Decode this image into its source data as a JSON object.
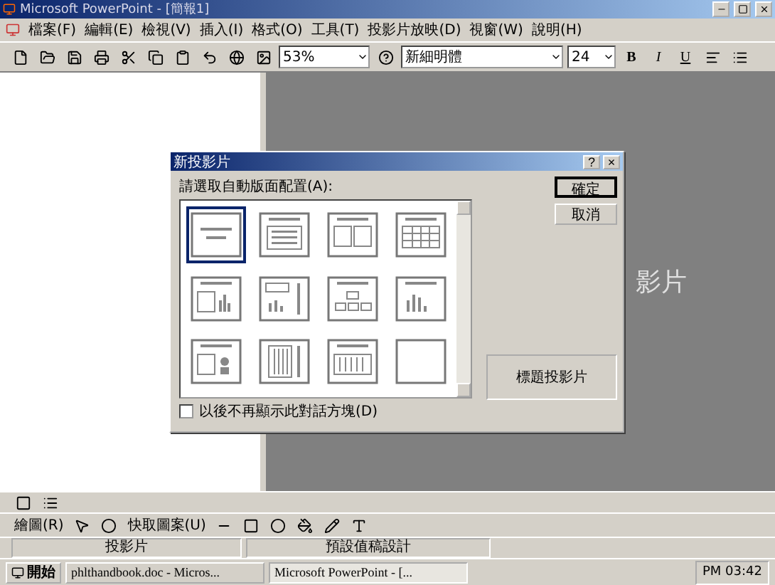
{
  "window": {
    "title": "Microsoft PowerPoint - [簡報1]"
  },
  "menu": [
    "檔案(F)",
    "編輯(E)",
    "檢視(V)",
    "插入(I)",
    "格式(O)",
    "工具(T)",
    "投影片放映(D)",
    "視窗(W)",
    "說明(H)"
  ],
  "toolbar": {
    "zoom": "53%",
    "font": "新細明體",
    "size": "24",
    "bold": "B",
    "italic": "I",
    "underline": "U"
  },
  "slide": {
    "text": "影片"
  },
  "dialog": {
    "title": "新投影片",
    "help": "?",
    "close": "×",
    "prompt": "請選取自動版面配置(A):",
    "layouts": [
      {
        "kind": "title",
        "selected": true
      },
      {
        "kind": "bullets",
        "selected": false
      },
      {
        "kind": "twocol",
        "selected": false
      },
      {
        "kind": "table",
        "selected": false
      },
      {
        "kind": "textchart",
        "selected": false
      },
      {
        "kind": "chartside",
        "selected": false
      },
      {
        "kind": "org",
        "selected": false
      },
      {
        "kind": "chart",
        "selected": false
      },
      {
        "kind": "textart",
        "selected": false
      },
      {
        "kind": "vertical",
        "selected": false
      },
      {
        "kind": "vtable",
        "selected": false
      },
      {
        "kind": "blank",
        "selected": false
      }
    ],
    "buttons": [
      "確定",
      "取消"
    ],
    "preview": "標題投影片",
    "checkbox": {
      "label": "以後不再顯示此對話方塊(D)",
      "checked": false
    }
  },
  "drawing_toolbar": {
    "draw": "繪圖(R)",
    "autoshapes": "快取圖案(U)"
  },
  "status_bar": [
    "投影片",
    "預設值稿設計"
  ],
  "taskbar": {
    "start": "開始",
    "tasks": [
      {
        "label": "phlthandbook.doc - Micros...",
        "selected": false
      },
      {
        "label": "Microsoft PowerPoint - [...",
        "selected": true
      }
    ],
    "clock": "PM 03:42"
  }
}
